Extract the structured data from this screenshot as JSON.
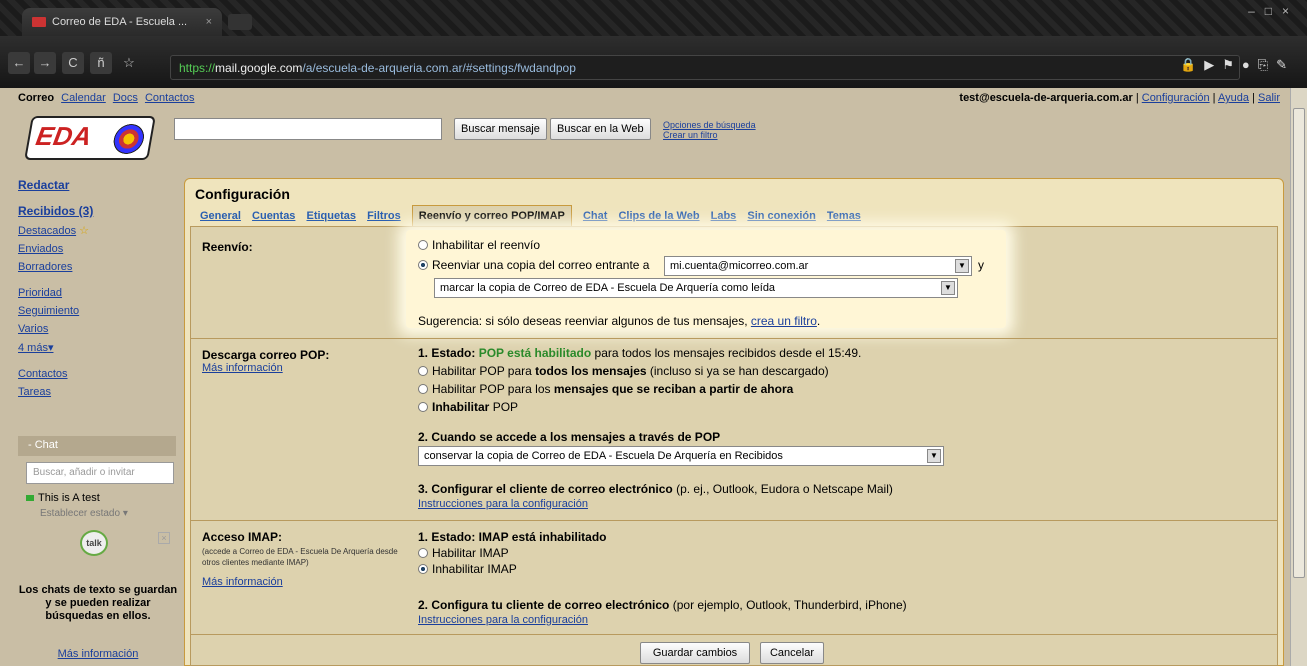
{
  "browser": {
    "tab_title": "Correo de EDA - Escuela ...",
    "tab_close": "×",
    "url_proto": "https://",
    "url_host": "mail.google.com",
    "url_path": "/a/escuela-de-arqueria.com.ar/#settings/fwdandpop",
    "back": "←",
    "forward": "→",
    "reload": "C",
    "home": "ñ",
    "star": "☆"
  },
  "topnav": {
    "app": "Correo",
    "links": [
      "Calendar",
      "Docs",
      "Contactos"
    ]
  },
  "account": {
    "email": "test@escuela-de-arqueria.com.ar",
    "links": [
      "Configuración",
      "Ayuda",
      "Salir"
    ]
  },
  "logo": "EDA",
  "search": {
    "buscar_mensaje": "Buscar mensaje",
    "buscar_web": "Buscar en la Web",
    "opciones": "Opciones de búsqueda",
    "filtro": "Crear un filtro"
  },
  "sidebar": {
    "compose": "Redactar",
    "inbox": "Recibidos (3)",
    "items": [
      "Destacados",
      "Enviados",
      "Borradores",
      "Prioridad",
      "Seguimiento",
      "Varios",
      "4 más▾",
      "Contactos",
      "Tareas"
    ]
  },
  "chat": {
    "header": "- Chat",
    "search_placeholder": "Buscar, añadir o invitar",
    "user": "This is A test",
    "status": "Establecer estado",
    "talk": "talk",
    "note": "Los chats de texto se guardan y se pueden realizar búsquedas en ellos.",
    "more": "Más información"
  },
  "settings": {
    "title": "Configuración",
    "tabs": [
      "General",
      "Cuentas",
      "Etiquetas",
      "Filtros",
      "Reenvío y correo POP/IMAP",
      "Chat",
      "Clips de la Web",
      "Labs",
      "Sin conexión",
      "Temas"
    ],
    "active_tab": "Reenvío y correo POP/IMAP",
    "forward": {
      "title": "Reenvío:",
      "disable": "Inhabilitar el reenvío",
      "enable": "Reenviar una copia del correo entrante a",
      "email": "mi.cuenta@micorreo.com.ar",
      "y": "y",
      "action": "marcar la copia de Correo de EDA - Escuela De Arquería como leída",
      "hint": "Sugerencia: si sólo deseas reenviar algunos de tus mensajes,",
      "hint_link": "crea un filtro",
      "hint_end": "."
    },
    "pop": {
      "title": "Descarga correo POP:",
      "more": "Más información",
      "status_label": "1. Estado:",
      "status_value": "POP está habilitado",
      "status_rest": "para todos los mensajes recibidos desde el 15:49.",
      "opt1_a": "Habilitar POP para",
      "opt1_b": "todos los mensajes",
      "opt1_c": "(incluso si ya se han descargado)",
      "opt2_a": "Habilitar POP para los",
      "opt2_b": "mensajes que se reciban a partir de ahora",
      "opt3_a": "Inhabilitar",
      "opt3_b": "POP",
      "step2": "2. Cuando se accede a los mensajes a través de POP",
      "step2_select": "conservar la copia de Correo de EDA - Escuela De Arquería en Recibidos",
      "step3_a": "3. Configurar el cliente de correo electrónico",
      "step3_b": "(p. ej., Outlook, Eudora o Netscape Mail)",
      "step3_link": "Instrucciones para la configuración"
    },
    "imap": {
      "title": "Acceso IMAP:",
      "desc": "(accede a Correo de EDA - Escuela De Arquería desde otros clientes mediante IMAP)",
      "more": "Más información",
      "status": "1. Estado: IMAP está inhabilitado",
      "enable": "Habilitar IMAP",
      "disable": "Inhabilitar IMAP",
      "step2_a": "2. Configura tu cliente de correo electrónico",
      "step2_b": "(por ejemplo, Outlook, Thunderbird, iPhone)",
      "step2_link": "Instrucciones para la configuración"
    },
    "save": "Guardar cambios",
    "cancel": "Cancelar"
  }
}
